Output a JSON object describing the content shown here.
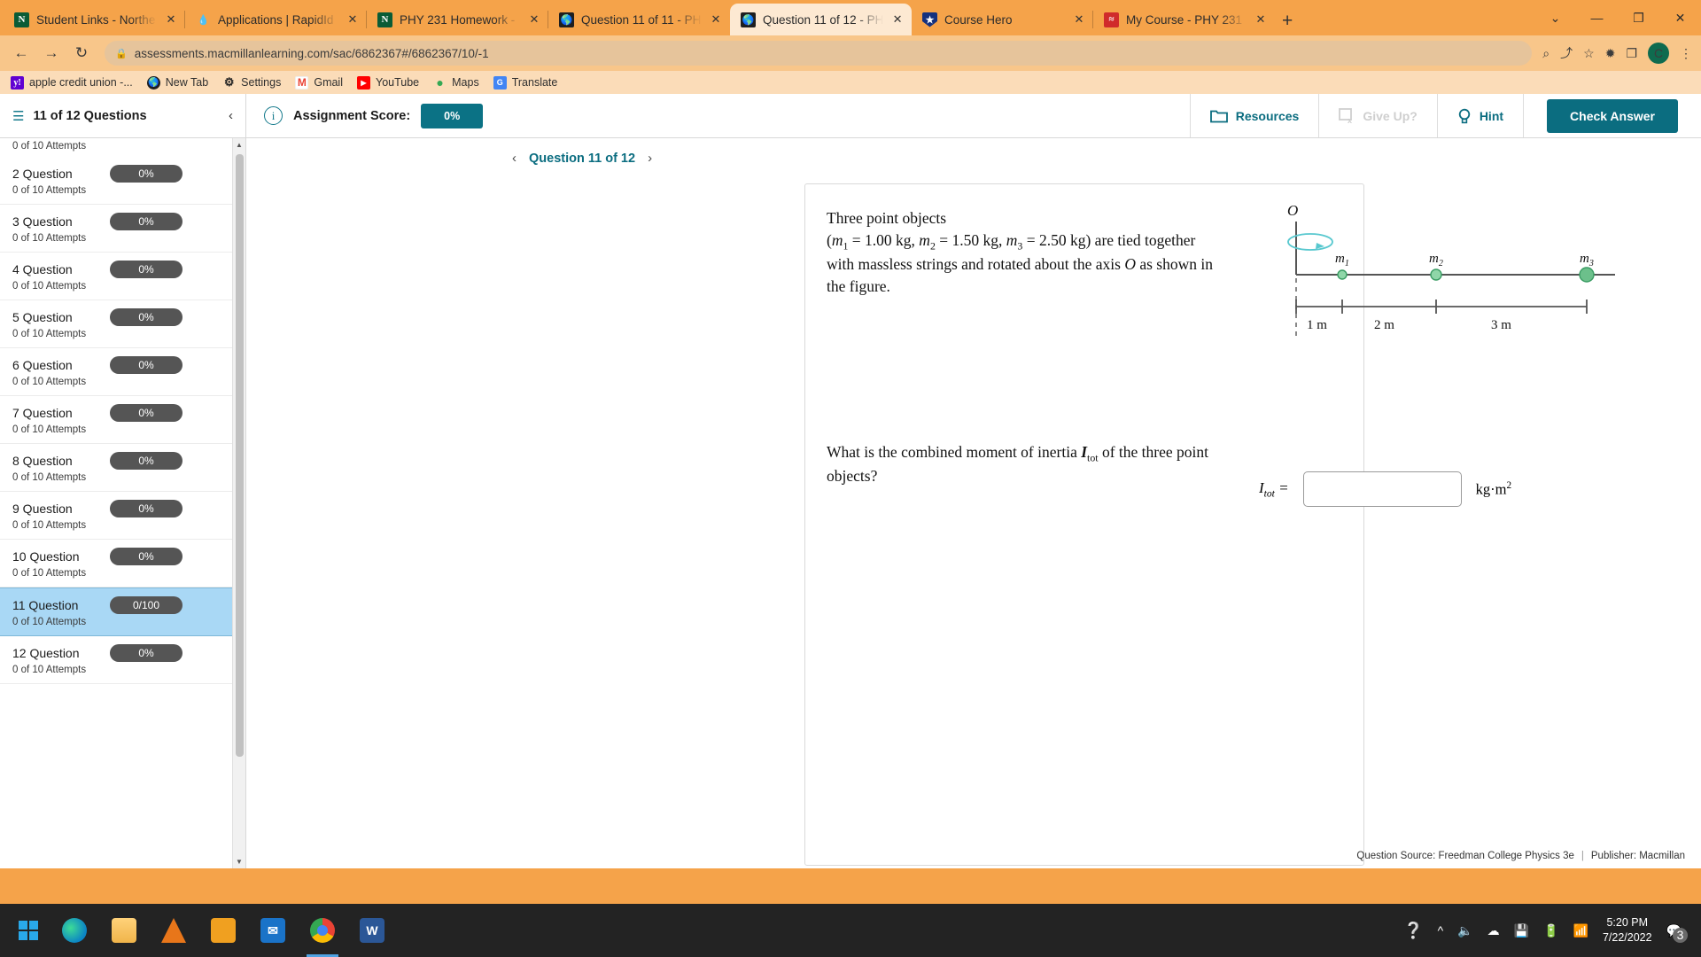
{
  "browser": {
    "tabs": [
      {
        "title": "Student Links - Northe",
        "favicon": "n-logo-icon",
        "active": false
      },
      {
        "title": "Applications | RapidId",
        "favicon": "droplet-icon",
        "active": false
      },
      {
        "title": "PHY 231 Homework -",
        "favicon": "n-logo-icon",
        "active": false
      },
      {
        "title": "Question 11 of 11 - PH",
        "favicon": "globe-icon",
        "active": false
      },
      {
        "title": "Question 11 of 12 - PH",
        "favicon": "globe-icon",
        "active": true
      },
      {
        "title": "Course Hero",
        "favicon": "shield-icon",
        "active": false
      },
      {
        "title": "My Course - PHY 231",
        "favicon": "canvas-icon",
        "active": false
      }
    ],
    "new_tab_label": "+",
    "close_glyph": "✕",
    "window_controls": {
      "minimize": "—",
      "maximize": "❐",
      "close": "✕",
      "chevron": "⌄"
    },
    "nav": {
      "back": "←",
      "forward": "→",
      "reload": "↻"
    },
    "url": "assessments.macmillanlearning.com/sac/6862367#/6862367/10/-1",
    "lock_icon": "🔒",
    "omni_actions": {
      "zoom": "⌕",
      "share": "⤴",
      "bookmark": "☆",
      "extensions": "✹",
      "sidebar": "❐",
      "menu": "⋮"
    },
    "profile_initial": "C",
    "bookmarks": [
      {
        "label": "apple credit union -...",
        "icon": "yahoo-icon"
      },
      {
        "label": "New Tab",
        "icon": "globe-icon"
      },
      {
        "label": "Settings",
        "icon": "gear-icon"
      },
      {
        "label": "Gmail",
        "icon": "gmail-icon"
      },
      {
        "label": "YouTube",
        "icon": "youtube-icon"
      },
      {
        "label": "Maps",
        "icon": "maps-pin-icon"
      },
      {
        "label": "Translate",
        "icon": "translate-icon"
      }
    ]
  },
  "app": {
    "question_count_label": "11 of 12 Questions",
    "collapse_glyph": "‹",
    "assignment_score_label": "Assignment Score:",
    "assignment_score_value": "0%",
    "toolbar": {
      "resources_label": "Resources",
      "give_up_label": "Give Up?",
      "hint_label": "Hint",
      "check_answer_label": "Check Answer"
    },
    "accent_color": "#0b6d80",
    "question_nav": {
      "prev": "‹",
      "next": "›",
      "label": "Question 11 of 12"
    },
    "sidebar_items": [
      {
        "name": "2 Question",
        "badge": "0%",
        "attempts": "0 of 10 Attempts",
        "active": false
      },
      {
        "name": "3 Question",
        "badge": "0%",
        "attempts": "0 of 10 Attempts",
        "active": false
      },
      {
        "name": "4 Question",
        "badge": "0%",
        "attempts": "0 of 10 Attempts",
        "active": false
      },
      {
        "name": "5 Question",
        "badge": "0%",
        "attempts": "0 of 10 Attempts",
        "active": false
      },
      {
        "name": "6 Question",
        "badge": "0%",
        "attempts": "0 of 10 Attempts",
        "active": false
      },
      {
        "name": "7 Question",
        "badge": "0%",
        "attempts": "0 of 10 Attempts",
        "active": false
      },
      {
        "name": "8 Question",
        "badge": "0%",
        "attempts": "0 of 10 Attempts",
        "active": false
      },
      {
        "name": "9 Question",
        "badge": "0%",
        "attempts": "0 of 10 Attempts",
        "active": false
      },
      {
        "name": "10 Question",
        "badge": "0%",
        "attempts": "0 of 10 Attempts",
        "active": false
      },
      {
        "name": "11 Question",
        "badge": "0/100",
        "attempts": "0 of 10 Attempts",
        "active": true
      },
      {
        "name": "12 Question",
        "badge": "0%",
        "attempts": "0 of 10 Attempts",
        "active": false
      }
    ],
    "top_partial_attempts": "0 of 10 Attempts"
  },
  "question": {
    "stem_line1": "Three point objects",
    "stem_line2_prefix": "(",
    "m1_symbol": "m",
    "m1_sub": "1",
    "m1_value": " = 1.00 kg, ",
    "m2_symbol": "m",
    "m2_sub": "2",
    "m2_value": " = 1.50 kg, ",
    "m3_symbol": "m",
    "m3_sub": "3",
    "m3_value": " = 2.50 kg) are tied together",
    "stem_line3a": "with massless strings and rotated about the axis ",
    "axis_symbol": "O",
    "stem_line3b": " as shown in",
    "stem_line4": "the figure.",
    "prompt_a": "What is the combined moment of inertia ",
    "prompt_i": "I",
    "prompt_i_sub": "tot",
    "prompt_b": " of the three point",
    "prompt_c": "objects?",
    "answer_label_symbol": "I",
    "answer_label_sub": "tot",
    "answer_equals": "=",
    "answer_value": "",
    "answer_units_base": "kg·m",
    "answer_units_exp": "2",
    "source_text": "Question Source: Freedman College Physics 3e",
    "publisher_text": "Publisher: Macmillan"
  },
  "figure": {
    "axis_label": "O",
    "mass_labels": [
      "m",
      "m",
      "m"
    ],
    "mass_subs": [
      "1",
      "2",
      "3"
    ],
    "distance_labels": [
      "1 m",
      "2 m",
      "3 m"
    ],
    "dot_color": "#6cc08b",
    "rotation_arrow_color": "#58c8cf",
    "line_color": "#555555"
  },
  "taskbar": {
    "apps": [
      "start-icon",
      "edge-icon",
      "file-explorer-icon",
      "vlc-icon",
      "store-icon",
      "mail-icon",
      "chrome-icon",
      "word-icon"
    ],
    "time": "5:20 PM",
    "date": "7/22/2022",
    "notification_count": "3",
    "tray_icons": [
      "help-icon",
      "chevron-up-icon",
      "volume-icon",
      "cloud-off-icon",
      "onedrive-icon",
      "battery-icon",
      "wifi-icon"
    ]
  }
}
